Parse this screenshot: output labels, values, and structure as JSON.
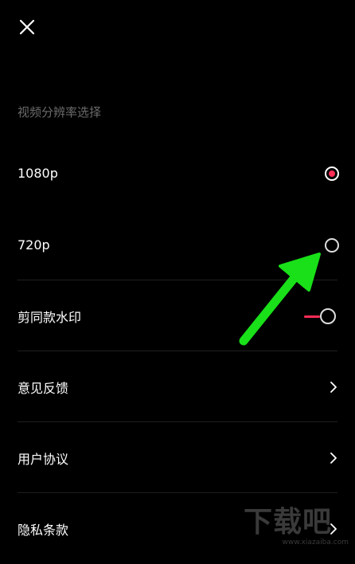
{
  "header": {
    "close_icon": "close-icon"
  },
  "section": {
    "title": "视频分辨率选择"
  },
  "resolution": [
    {
      "label": "1080p",
      "selected": true
    },
    {
      "label": "720p",
      "selected": false
    }
  ],
  "settings": {
    "watermark_label": "剪同款水印",
    "watermark_toggle_on": true,
    "feedback_label": "意见反馈",
    "agreement_label": "用户协议",
    "privacy_label": "隐私条款"
  },
  "overlay": {
    "watermark_text": "下载吧",
    "watermark_url": "www.xiazaiba.com"
  },
  "colors": {
    "accent": "#fe2c55",
    "annotation_arrow": "#19e019",
    "background": "#000000"
  }
}
